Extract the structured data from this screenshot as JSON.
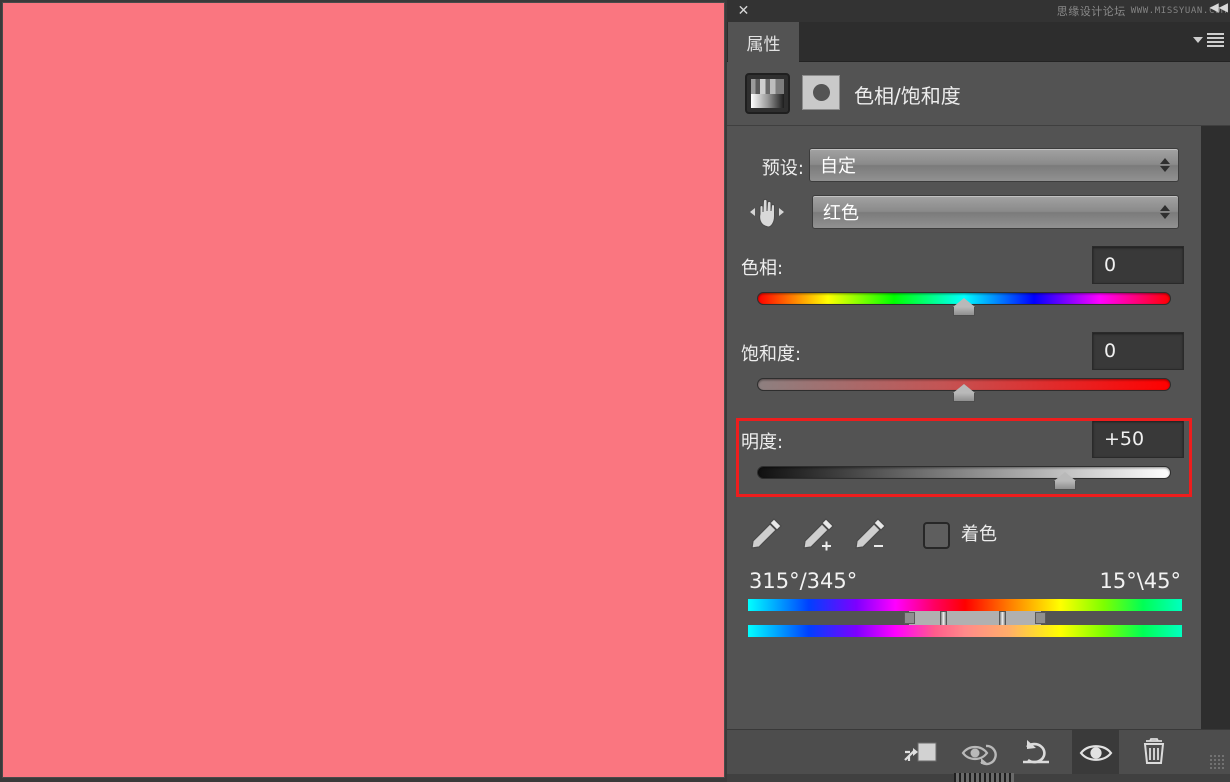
{
  "window": {
    "close_label": "✕",
    "collapse_label": "◀◀",
    "watermark_cn": "思缘设计论坛",
    "watermark_url": "WWW.MISSYUAN.COM"
  },
  "panel": {
    "tab_label": "属性",
    "title": "色相/饱和度",
    "menu_icon": "panel-menu-icon"
  },
  "preset": {
    "label": "预设:",
    "value": "自定"
  },
  "channel": {
    "value": "红色",
    "targeted_icon": "hand-targeted-adjustment-icon"
  },
  "sliders": [
    {
      "key": "hue",
      "label": "色相:",
      "value": "0",
      "position_pct": 50,
      "min": -180,
      "max": 180
    },
    {
      "key": "saturation",
      "label": "饱和度:",
      "value": "0",
      "position_pct": 50,
      "min": -100,
      "max": 100
    },
    {
      "key": "lightness",
      "label": "明度:",
      "value": "+50",
      "position_pct": 74,
      "min": -100,
      "max": 100,
      "highlighted": true,
      "highlight_color": "#ee1d1d"
    }
  ],
  "tools": {
    "eyedropper_sample": "eyedropper-icon",
    "eyedropper_add": "eyedropper-plus-icon",
    "eyedropper_subtract": "eyedropper-minus-icon",
    "colorize_label": "着色",
    "colorize_checked": false
  },
  "hue_range": {
    "left_degrees": "315°/345°",
    "right_degrees": "15°\\45°"
  },
  "footer": {
    "clip_label": "clip-to-layer-icon",
    "preview_label": "toggle-previous-state-icon",
    "reset_label": "reset-icon",
    "visible_label": "toggle-visibility-icon",
    "delete_label": "delete-layer-icon",
    "visible_active": true
  },
  "colors": {
    "canvas": "#fa7680",
    "panel_bg": "#535353",
    "dock_bg": "#2e2e2e",
    "highlight": "#ee1d1d",
    "text": "#ededed"
  }
}
